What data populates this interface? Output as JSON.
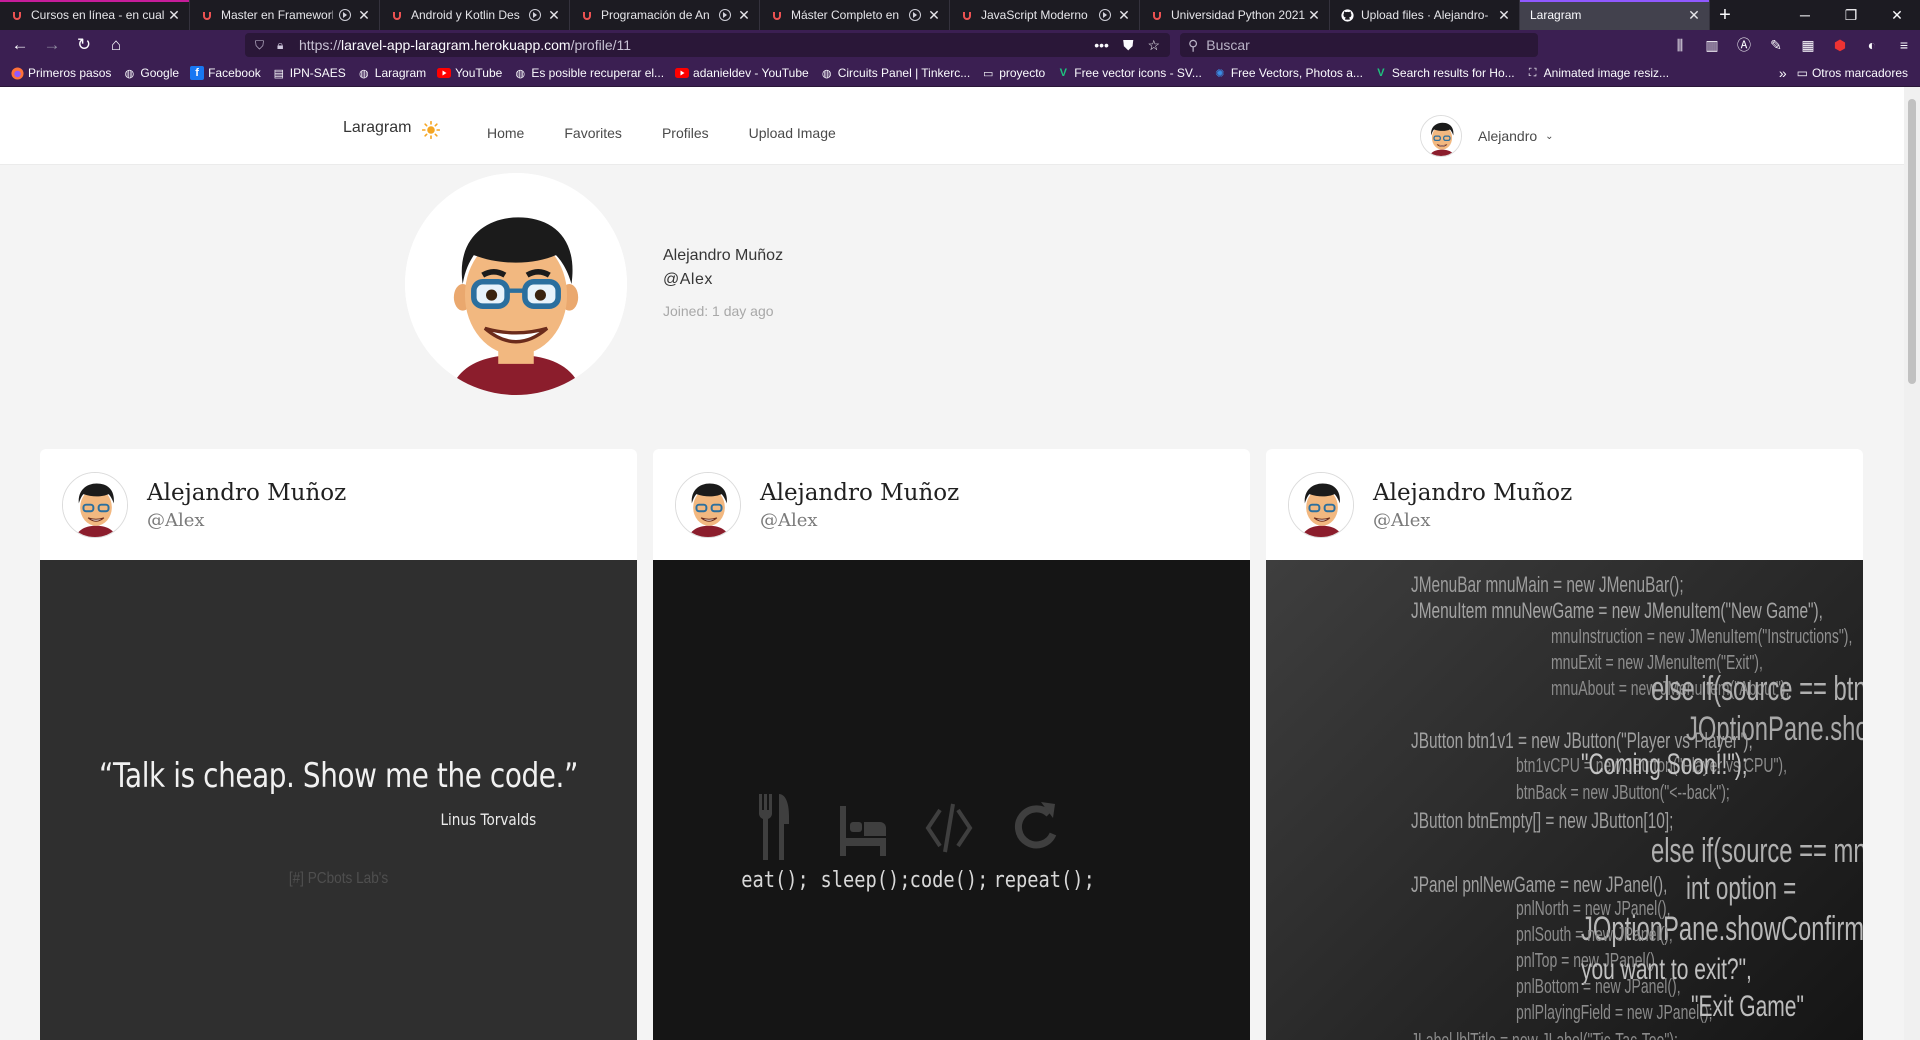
{
  "browser": {
    "tabs": [
      {
        "title": "Cursos en línea - en cual",
        "icon": "udemy-icon",
        "active": false
      },
      {
        "title": "Master en Framework",
        "icon": "udemy-icon",
        "active": false
      },
      {
        "title": "Android y Kotlin Des",
        "icon": "udemy-icon",
        "active": false
      },
      {
        "title": "Programación de An",
        "icon": "udemy-icon",
        "active": false
      },
      {
        "title": "Máster Completo en",
        "icon": "udemy-icon",
        "active": false
      },
      {
        "title": "JavaScript Moderno",
        "icon": "udemy-icon",
        "active": false
      },
      {
        "title": "Universidad Python 2021",
        "icon": "udemy-icon",
        "active": false
      },
      {
        "title": "Upload files · Alejandro-",
        "icon": "github-icon",
        "active": false
      },
      {
        "title": "Laragram",
        "icon": "",
        "active": true
      }
    ],
    "url": {
      "scheme": "https://",
      "host": "laravel-app-laragram.herokuapp.com",
      "path": "/profile/11"
    },
    "search_placeholder": "Buscar",
    "bookmarks": [
      {
        "label": "Primeros pasos",
        "icon": "firefox-icon"
      },
      {
        "label": "Google",
        "icon": "globe-icon"
      },
      {
        "label": "Facebook",
        "icon": "facebook-icon"
      },
      {
        "label": "IPN-SAES",
        "icon": "document-icon"
      },
      {
        "label": "Laragram",
        "icon": "globe-icon"
      },
      {
        "label": "YouTube",
        "icon": "youtube-icon"
      },
      {
        "label": "Es posible recuperar el...",
        "icon": "globe-icon"
      },
      {
        "label": "adanieldev - YouTube",
        "icon": "youtube-icon"
      },
      {
        "label": "Circuits Panel | Tinkerc...",
        "icon": "globe-icon"
      },
      {
        "label": "proyecto",
        "icon": "folder-icon"
      },
      {
        "label": "Free vector icons - SV...",
        "icon": "vector-icon"
      },
      {
        "label": "Free Vectors, Photos a...",
        "icon": "freepik-icon"
      },
      {
        "label": "Search results for Ho...",
        "icon": "vector-icon"
      },
      {
        "label": "Animated image resiz...",
        "icon": "resize-icon"
      }
    ],
    "other_bookmarks": "Otros marcadores"
  },
  "app": {
    "brand": "Laragram",
    "nav": [
      "Home",
      "Favorites",
      "Profiles",
      "Upload Image"
    ],
    "user_menu_name": "Alejandro"
  },
  "profile": {
    "name": "Alejandro Muñoz",
    "handle": "@Alex",
    "joined": "Joined: 1 day ago"
  },
  "posts": [
    {
      "author": "Alejandro Muñoz",
      "handle": "@Alex",
      "quote": "“Talk is cheap. Show me the code.”",
      "quote_author": "Linus Torvalds",
      "watermark": "[#] PCbots Lab's"
    },
    {
      "author": "Alejandro Muñoz",
      "handle": "@Alex",
      "habits": [
        {
          "icon": "fork-knife-icon",
          "label": "eat();"
        },
        {
          "icon": "bed-icon",
          "label": "sleep();"
        },
        {
          "icon": "code-icon",
          "label": "code();"
        },
        {
          "icon": "repeat-icon",
          "label": "repeat();"
        }
      ]
    },
    {
      "author": "Alejandro Muñoz",
      "handle": "@Alex",
      "code_lines": [
        "JMenuBar mnuMain = new JMenuBar();",
        "JMenuItem    mnuNewGame = new JMenuItem(\"New Game\"),",
        "mnuInstruction = new JMenuItem(\"Instructions\"),",
        "mnuExit = new JMenuItem(\"Exit\"),",
        "mnuAbout = new JMenuItem(\"About\");",
        "else if(source == btn",
        "JOptionPane.sho",
        "JButton    btn1v1 = new JButton(\"Player vs Player\"),",
        "btn1vCPU = new JButton(\"Player vs CPU\"),",
        "\"Coming Soon!!\");",
        "btnBack = new JButton(\"<--back\");",
        "JButton btnEmpty[] = new JButton[10];",
        "else if(source == mnu",
        "JPanel    pnlNewGame = new JPanel(),",
        "int option =",
        "pnlNorth = new JPanel(),",
        "JOptionPane.showConfirm",
        "pnlSouth = new JPanel(),",
        "pnlTop = new JPanel(),",
        "you want to exit?\",",
        "pnlBottom = new JPanel(),",
        "pnlPlayingField = new JPanel();",
        "\"Exit Game\"",
        "JLabel lblTitle = new JLabel(\"Tic-Tac-Toe\");"
      ]
    }
  ],
  "colors": {
    "tab_accent": "#9059ff",
    "chrome_bg": "#3b1f52",
    "sun": "#f5a623"
  }
}
